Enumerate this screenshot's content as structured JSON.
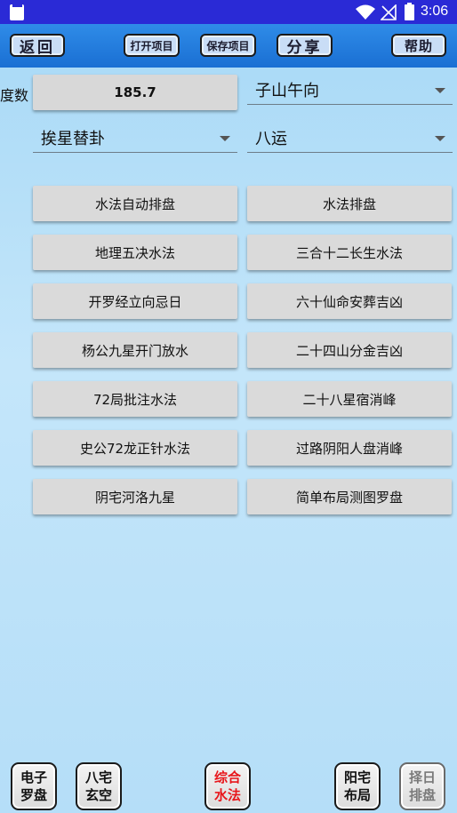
{
  "status_bar": {
    "time": "3:06",
    "icons": [
      "sd-card-icon",
      "wifi-icon",
      "signal-off-icon",
      "battery-icon"
    ]
  },
  "toolbar": {
    "back": "返回",
    "open_project": "打开项目",
    "save_project": "保存项目",
    "share": "分享",
    "help": "帮助"
  },
  "form": {
    "degree_label": "度数",
    "degree_value": "185.7",
    "mountain_select": "子山午向",
    "method_select": "挨星替卦",
    "period_select": "八运"
  },
  "functions": [
    "水法自动排盘",
    "水法排盘",
    "地理五决水法",
    "三合十二长生水法",
    "开罗经立向忌日",
    "六十仙命安葬吉凶",
    "杨公九星开门放水",
    "二十四山分金吉凶",
    "72局批注水法",
    "二十八星宿消峰",
    "史公72龙正针水法",
    "过路阴阳人盘消峰",
    "阴宅河洛九星",
    "简单布局测图罗盘"
  ],
  "bottom_nav": [
    {
      "line1": "电子",
      "line2": "罗盘",
      "state": "normal"
    },
    {
      "line1": "八宅",
      "line2": "玄空",
      "state": "normal"
    },
    {
      "line1": "综合",
      "line2": "水法",
      "state": "active"
    },
    {
      "line1": "阳宅",
      "line2": "布局",
      "state": "normal"
    },
    {
      "line1": "择日",
      "line2": "排盘",
      "state": "disabled"
    }
  ],
  "colors": {
    "status_bar": "#2a2ad6",
    "toolbar": "#1a6fd3",
    "background": "#b5def8",
    "active_nav": "#e8161b"
  }
}
